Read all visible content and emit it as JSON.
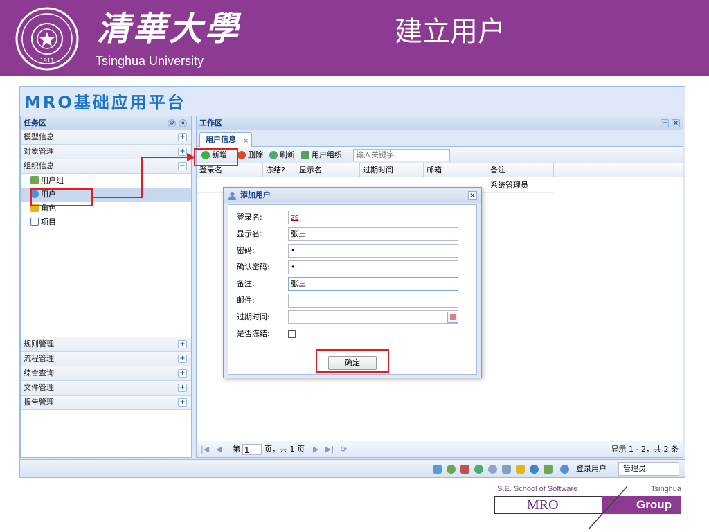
{
  "slide": {
    "university_cn": "清華大學",
    "university_en": "Tsinghua University",
    "title": "建立用户",
    "seal_text": "1911"
  },
  "app": {
    "title": "MRO基础应用平台",
    "task_panel": {
      "title": "任务区",
      "sections": [
        {
          "label": "模型信息",
          "expanded": false
        },
        {
          "label": "对象管理",
          "expanded": false
        },
        {
          "label": "组织信息",
          "expanded": true
        }
      ],
      "tree_items": [
        {
          "label": "用户组",
          "icon": "users-group-icon"
        },
        {
          "label": "用户",
          "icon": "user-icon",
          "selected": true
        },
        {
          "label": "角色",
          "icon": "key-icon"
        },
        {
          "label": "项目",
          "icon": "project-icon"
        }
      ],
      "bottom_sections": [
        {
          "label": "规则管理"
        },
        {
          "label": "流程管理"
        },
        {
          "label": "综合查询"
        },
        {
          "label": "文件管理"
        },
        {
          "label": "报告管理"
        }
      ],
      "expand_symbol": "+",
      "collapse_symbol": "−"
    },
    "work_area": {
      "title": "工作区",
      "tab": {
        "label": "用户信息",
        "close": "×"
      },
      "toolbar": {
        "add": "新增",
        "delete": "删除",
        "refresh": "刷新",
        "user_org": "用户组织",
        "search_placeholder": "输入关键字"
      },
      "grid": {
        "columns": [
          "登录名",
          "冻结?",
          "显示名",
          "过期时间",
          "邮箱",
          "备注"
        ],
        "rows": [
          {
            "note": "系统管理员"
          },
          {
            "note": ""
          }
        ]
      },
      "pager": {
        "page_prefix": "第",
        "page_value": "1",
        "page_suffix": "页，共 1 页",
        "info": "显示 1 - 2，共 2 条"
      },
      "minimize": "−",
      "close": "×"
    },
    "status_bar": {
      "login_label": "登录用户",
      "login_value": "管理员"
    }
  },
  "dialog": {
    "title": "添加用户",
    "close": "×",
    "fields": {
      "login_name": {
        "label": "登录名:",
        "value": "zs"
      },
      "display_name": {
        "label": "显示名:",
        "value": "张三"
      },
      "password": {
        "label": "密码:",
        "value": "•"
      },
      "confirm_password": {
        "label": "确认密码:",
        "value": "•"
      },
      "note": {
        "label": "备注:",
        "value": "张三"
      },
      "email": {
        "label": "邮件:",
        "value": ""
      },
      "expire_time": {
        "label": "过期时间:",
        "value": ""
      },
      "frozen": {
        "label": "是否冻结:",
        "checked": false
      }
    },
    "ok_label": "确定"
  },
  "footer": {
    "school": "I.S.E. School of Software",
    "tsinghua": "Tsinghua",
    "mro": "MRO",
    "group": "Group"
  },
  "colors": {
    "banner": "#8d3a93",
    "app_title": "#1b73c9",
    "highlight": "#e02020"
  }
}
